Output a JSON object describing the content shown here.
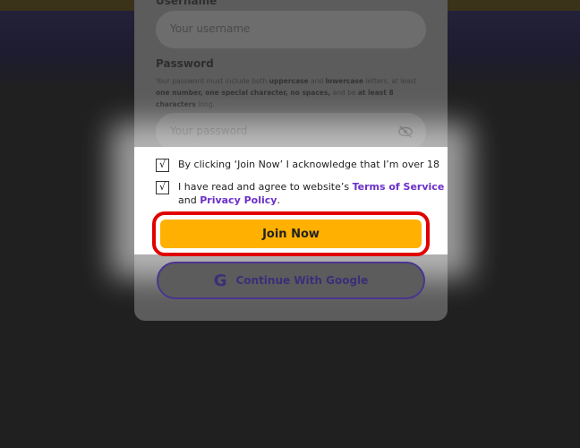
{
  "form": {
    "username_label": "Username",
    "username_placeholder": "Your username",
    "password_label": "Password",
    "password_hint_parts": [
      "Your password must include both ",
      "uppercase",
      " and ",
      "lowercase",
      " letters, at least ",
      "one number, one special character, no spaces,",
      " and be ",
      "at least 8 characters",
      " long."
    ],
    "password_placeholder": "Your password",
    "age_checkbox_text": "By clicking ‘Join Now’ I acknowledge that I’m over 18",
    "terms_prefix": "I have read and agree to website’s ",
    "terms_link": "Terms of Service",
    "and_text": "and ",
    "privacy_link": "Privacy Policy",
    "period": ".",
    "checkbox_mark": "√",
    "join_button": "Join Now",
    "google_icon": "G",
    "google_button": "Continue With Google"
  },
  "colors": {
    "join_button": "#ffb000",
    "highlight_border": "#e00000",
    "link": "#6b2fc9"
  },
  "icons": [
    "eye-slash-icon",
    "google-icon",
    "checkbox-checked-icon"
  ]
}
